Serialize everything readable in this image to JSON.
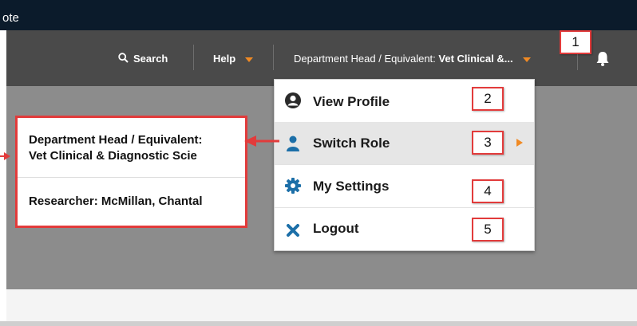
{
  "topbar": {
    "text": "ote"
  },
  "nav": {
    "search_label": "Search",
    "help_label": "Help",
    "role_prefix": "Department Head / Equivalent: ",
    "role_value": "Vet Clinical &...",
    "search_icon": "search-icon",
    "bell_icon": "bell-icon"
  },
  "menu": {
    "items": [
      {
        "label": "View Profile",
        "icon": "user-circle-icon",
        "callout": "2"
      },
      {
        "label": "Switch Role",
        "icon": "person-icon",
        "callout": "3"
      },
      {
        "label": "My Settings",
        "icon": "gear-icon",
        "callout": "4"
      },
      {
        "label": "Logout",
        "icon": "close-x-icon",
        "callout": "5"
      }
    ]
  },
  "callouts": {
    "role_menu": "1"
  },
  "roles": [
    {
      "line1": "Department Head / Equivalent:",
      "line2": "Vet Clinical & Diagnostic Scie"
    },
    {
      "line1": "Researcher: McMillan, Chantal"
    }
  ],
  "colors": {
    "accent": "#f08a24",
    "callout_border": "#e23b3b",
    "icon_blue": "#1c6fa8",
    "navbar": "#4a4a4a",
    "topbar": "#0b1b2b"
  }
}
